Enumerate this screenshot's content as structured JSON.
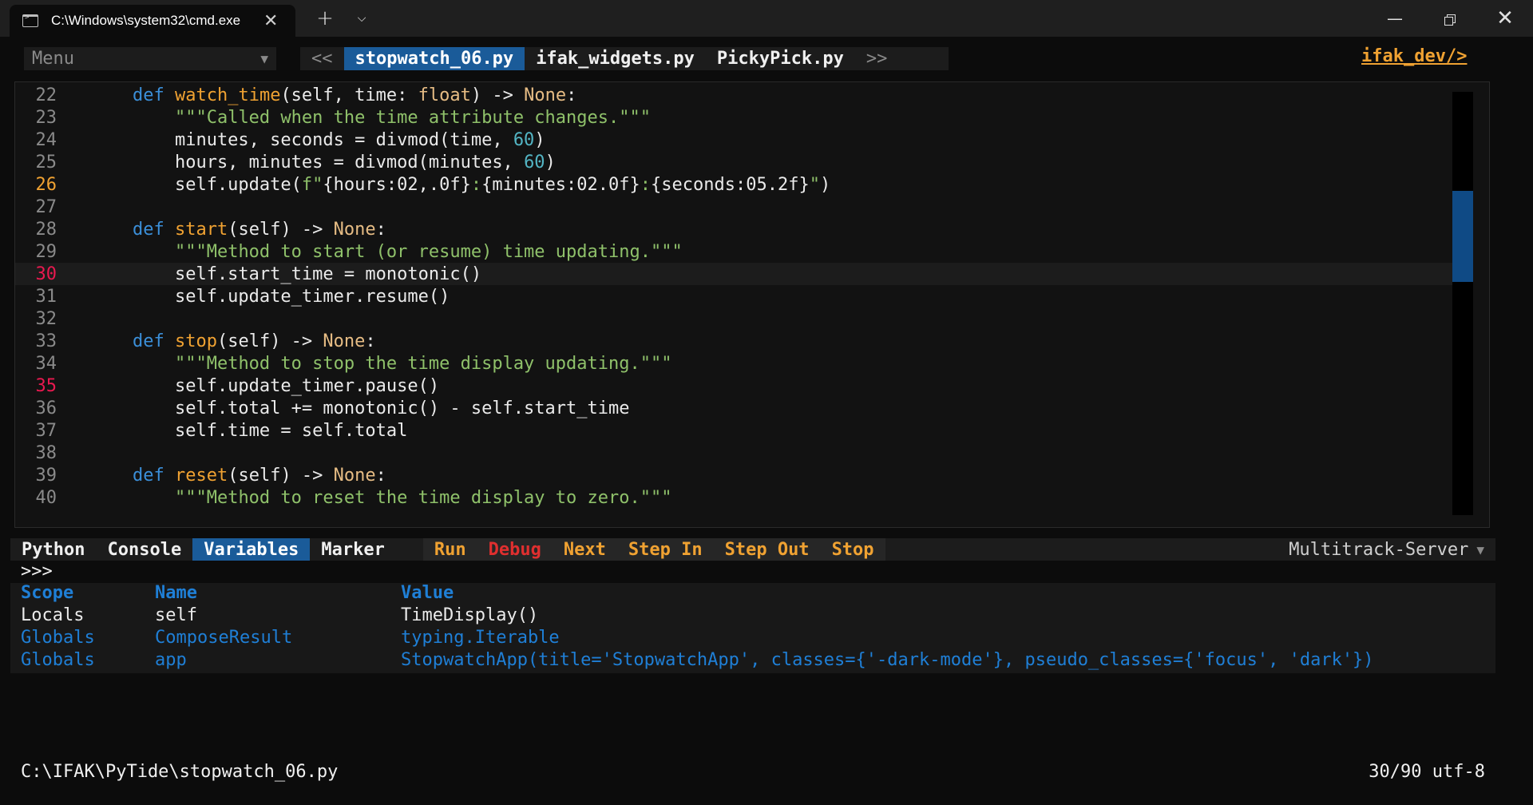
{
  "window": {
    "tab_title": "C:\\Windows\\system32\\cmd.exe",
    "new_tab_glyph": "+",
    "dropdown_glyph": "⌵",
    "minimize_glyph": "—",
    "close_glyph": "✕",
    "tab_close_glyph": "✕"
  },
  "topbar": {
    "menu_label": "Menu",
    "menu_arrow": "▼",
    "prev": "<<",
    "next": ">>",
    "files": [
      "stopwatch_06.py",
      "ifak_widgets.py",
      "PickyPick.py"
    ],
    "active_file": "stopwatch_06.py",
    "brand": "ifak_dev/>"
  },
  "editor": {
    "lines": [
      {
        "n": "22",
        "code": "    def watch_time(self, time: float) -> None:"
      },
      {
        "n": "23",
        "code": "        \"\"\"Called when the time attribute changes.\"\"\""
      },
      {
        "n": "24",
        "code": "        minutes, seconds = divmod(time, 60)"
      },
      {
        "n": "25",
        "code": "        hours, minutes = divmod(minutes, 60)"
      },
      {
        "n": "26",
        "code": "        self.update(f\"{hours:02,.0f}:{minutes:02.0f}:{seconds:05.2f}\")"
      },
      {
        "n": "27",
        "code": ""
      },
      {
        "n": "28",
        "code": "    def start(self) -> None:"
      },
      {
        "n": "29",
        "code": "        \"\"\"Method to start (or resume) time updating.\"\"\""
      },
      {
        "n": "30",
        "code": "        self.start_time = monotonic()"
      },
      {
        "n": "31",
        "code": "        self.update_timer.resume()"
      },
      {
        "n": "32",
        "code": ""
      },
      {
        "n": "33",
        "code": "    def stop(self) -> None:"
      },
      {
        "n": "34",
        "code": "        \"\"\"Method to stop the time display updating.\"\"\""
      },
      {
        "n": "35",
        "code": "        self.update_timer.pause()"
      },
      {
        "n": "36",
        "code": "        self.total += monotonic() - self.start_time"
      },
      {
        "n": "37",
        "code": "        self.time = self.total"
      },
      {
        "n": "38",
        "code": ""
      },
      {
        "n": "39",
        "code": "    def reset(self) -> None:"
      },
      {
        "n": "40",
        "code": "        \"\"\"Method to reset the time display to zero.\"\"\""
      }
    ],
    "current_line": "26",
    "breakpoint_lines": [
      "30",
      "35"
    ],
    "highlighted_line": "30"
  },
  "panel": {
    "tabs": [
      "Python",
      "Console",
      "Variables",
      "Marker"
    ],
    "active_tab": "Variables",
    "actions": [
      "Run",
      "Debug",
      "Next",
      "Step In",
      "Step Out",
      "Stop"
    ],
    "server": "Multitrack-Server",
    "server_arrow": "▼",
    "prompt": ">>>",
    "var_headers": {
      "scope": "Scope",
      "name": "Name",
      "value": "Value"
    },
    "variables": [
      {
        "scope": "Locals",
        "name": "self",
        "value": "TimeDisplay()"
      },
      {
        "scope": "Globals",
        "name": "ComposeResult",
        "value": "typing.Iterable"
      },
      {
        "scope": "Globals",
        "name": "app",
        "value": "StopwatchApp(title='StopwatchApp', classes={'-dark-mode'}, pseudo_classes={'focus', 'dark'})"
      }
    ]
  },
  "status": {
    "path": "C:\\IFAK\\PyTide\\stopwatch_06.py",
    "position": "30/90 utf-8"
  },
  "colors": {
    "background": "#0c0c0c",
    "accent_blue": "#1a5b99",
    "keyword": "#3b8fd9",
    "function": "#f0a232",
    "string": "#8fc16a",
    "number": "#53b5c4",
    "breakpoint": "#e8194f",
    "debug": "#e02f2f"
  }
}
